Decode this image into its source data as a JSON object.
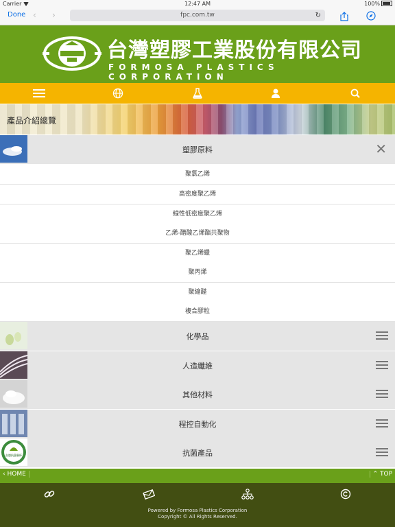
{
  "status": {
    "carrier": "Carrier",
    "time": "12:47 AM",
    "battery": "100%"
  },
  "browser": {
    "done": "Done",
    "url": "fpc.com.tw"
  },
  "header": {
    "logo_cn": "台灣塑膠工業股份有限公司",
    "logo_en": "FORMOSA PLASTICS CORPORATION"
  },
  "menu": {
    "icons": [
      "menu-icon",
      "globe-icon",
      "flask-icon",
      "user-icon",
      "search-icon"
    ]
  },
  "banner": {
    "title": "產品介紹總覽"
  },
  "expanded_category": {
    "label": "塑膠原料",
    "items": [
      "聚氯乙烯",
      "高密度聚乙烯",
      "線性低密度聚乙烯",
      "乙烯-醋酸乙烯酯共聚物",
      "聚乙烯蠟",
      "聚丙烯",
      "聚縮醛",
      "複合膠粒"
    ]
  },
  "categories": [
    {
      "label": "化學品"
    },
    {
      "label": "人造纖維"
    },
    {
      "label": "其他材料"
    },
    {
      "label": "程控自動化"
    },
    {
      "label": "抗菌產品",
      "thumb_text": "台塑抗菌餐杯"
    }
  ],
  "footer_nav": {
    "home": "HOME",
    "top": "TOP"
  },
  "footer": {
    "credit1": "Powered by    Formosa Plastics Corporation",
    "credit2": "Copyright © All Rights Reserved."
  },
  "colors": {
    "brand_green": "#6aa01a",
    "menu_yellow": "#f5b400",
    "footer_dark": "#424e12",
    "link_blue": "#0a6ee6"
  }
}
